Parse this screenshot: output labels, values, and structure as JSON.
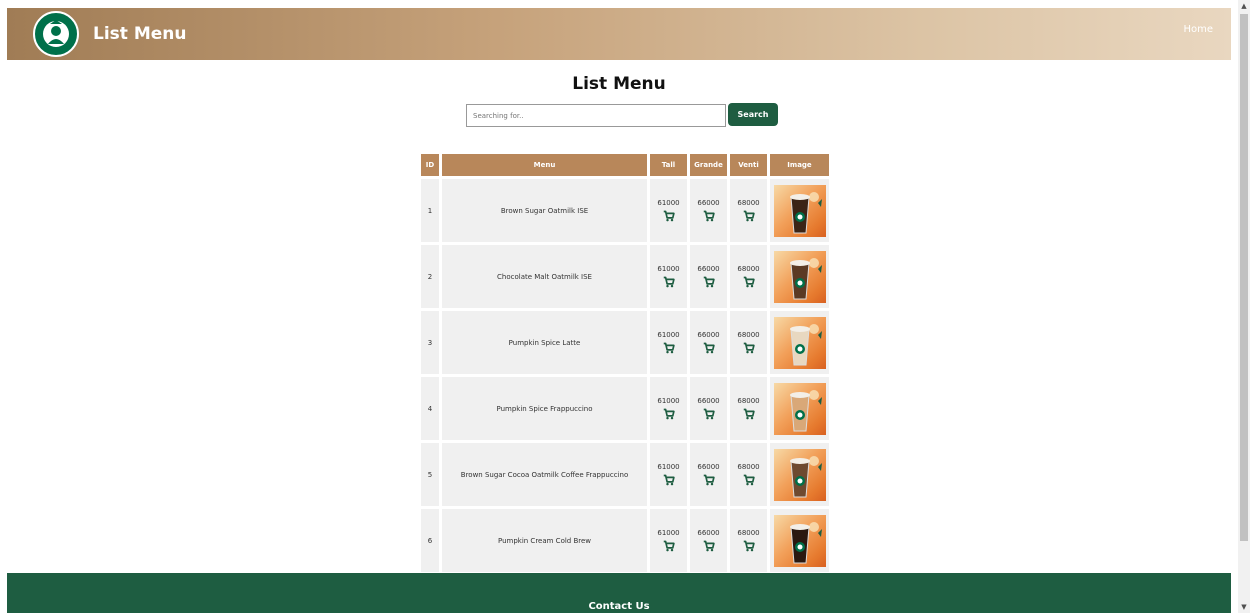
{
  "header": {
    "brand_title": "List Menu",
    "nav_home": "Home"
  },
  "main": {
    "page_title": "List Menu",
    "search_placeholder": "Searching for..",
    "search_button": "Search"
  },
  "table": {
    "headers": [
      "ID",
      "Menu",
      "Tall",
      "Grande",
      "Venti",
      "Image"
    ],
    "rows": [
      {
        "id": "1",
        "menu": "Brown Sugar Oatmilk ISE",
        "tall": "61000",
        "grande": "66000",
        "venti": "68000",
        "cup": "#3b2416"
      },
      {
        "id": "2",
        "menu": "Chocolate Malt Oatmilk ISE",
        "tall": "61000",
        "grande": "66000",
        "venti": "68000",
        "cup": "#5b3a24"
      },
      {
        "id": "3",
        "menu": "Pumpkin Spice Latte",
        "tall": "61000",
        "grande": "66000",
        "venti": "68000",
        "cup": "#e8d8c0"
      },
      {
        "id": "4",
        "menu": "Pumpkin Spice Frappuccino",
        "tall": "61000",
        "grande": "66000",
        "venti": "68000",
        "cup": "#d9a878"
      },
      {
        "id": "5",
        "menu": "Brown Sugar Cocoa Oatmilk Coffee Frappuccino",
        "tall": "61000",
        "grande": "66000",
        "venti": "68000",
        "cup": "#6e4a30"
      },
      {
        "id": "6",
        "menu": "Pumpkin Cream Cold Brew",
        "tall": "61000",
        "grande": "66000",
        "venti": "68000",
        "cup": "#2a1810"
      }
    ]
  },
  "footer": {
    "title": "Contact Us"
  },
  "colors": {
    "brand_green": "#1e5d41",
    "header_brown": "#b8875a"
  },
  "icons": {
    "cart": "cart-icon",
    "logo": "starbucks-logo"
  }
}
